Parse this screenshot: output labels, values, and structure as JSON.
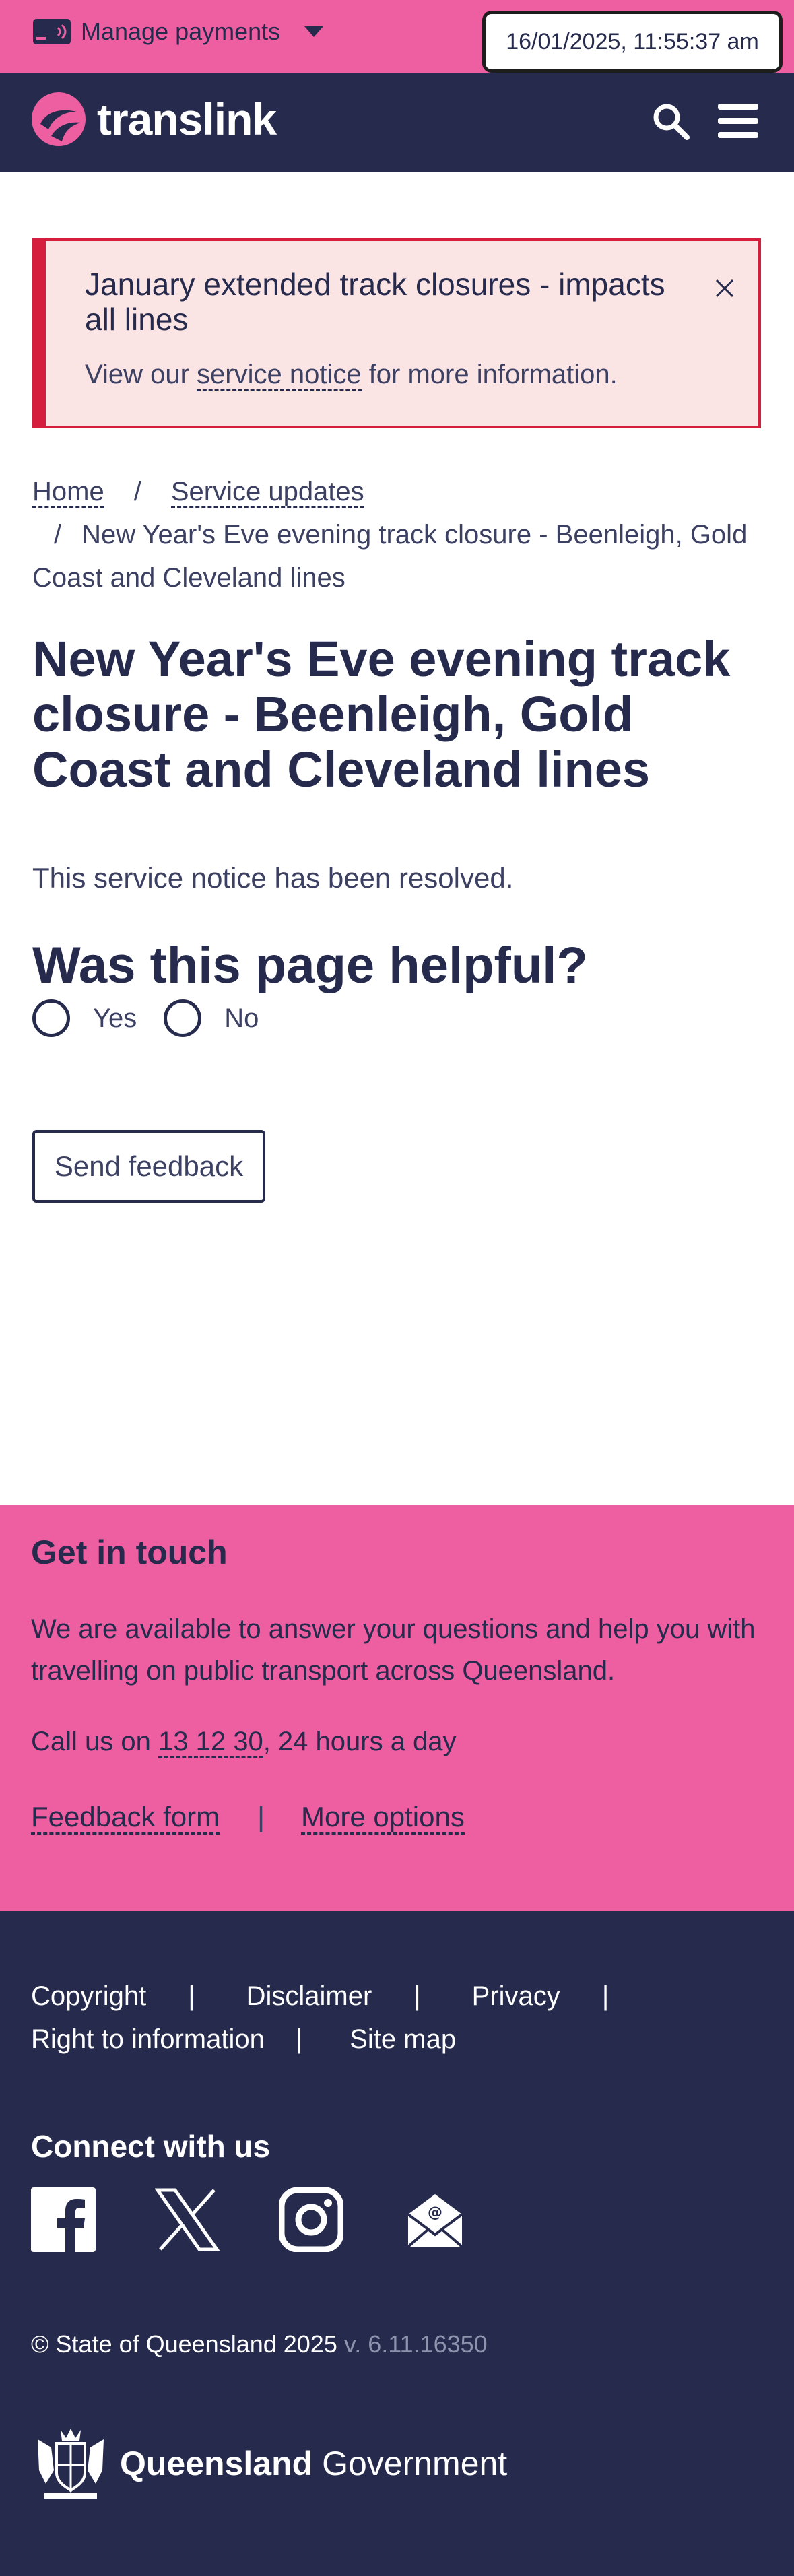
{
  "topbar": {
    "manage_payments": "Manage payments",
    "datetime": "16/01/2025, 11:55:37 am"
  },
  "header": {
    "brand": "translink"
  },
  "alert": {
    "title": "January extended track closures - impacts all lines",
    "body_prefix": "View our ",
    "body_link": "service notice",
    "body_suffix": " for more information."
  },
  "breadcrumb": {
    "separator": "/",
    "home": "Home",
    "service_updates": "Service updates",
    "current": "New Year's Eve evening track closure - Beenleigh, Gold Coast and Cleveland lines"
  },
  "main": {
    "title": "New Year's Eve evening track closure - Beenleigh, Gold Coast and Cleveland lines",
    "status": "This service notice has been resolved.",
    "helpful_heading": "Was this page helpful?",
    "yes_label": "Yes",
    "no_label": "No",
    "send_feedback": "Send feedback"
  },
  "contact": {
    "title": "Get in touch",
    "text": "We are available to answer your questions and help you with travelling on public transport across Queensland.",
    "call_prefix": "Call us on ",
    "phone": "13 12 30",
    "call_suffix": ", 24 hours a day",
    "feedback_form": "Feedback form",
    "separator": "|",
    "more_options": "More options"
  },
  "footer": {
    "links": [
      "Copyright",
      "Disclaimer",
      "Privacy",
      "Right to information",
      "Site map"
    ],
    "separator": "|",
    "connect_title": "Connect with us",
    "social_icons": [
      "facebook-icon",
      "x-icon",
      "instagram-icon",
      "email-icon"
    ],
    "copyright": "© State of Queensland 2025",
    "version": " v. 6.11.16350",
    "gov_bold": "Queensland",
    "gov_regular": " Government"
  },
  "colors": {
    "pink": "#ee5fa1",
    "navy": "#262b4d",
    "alert_red": "#d51e3d",
    "alert_bg": "#fbe4e4"
  }
}
